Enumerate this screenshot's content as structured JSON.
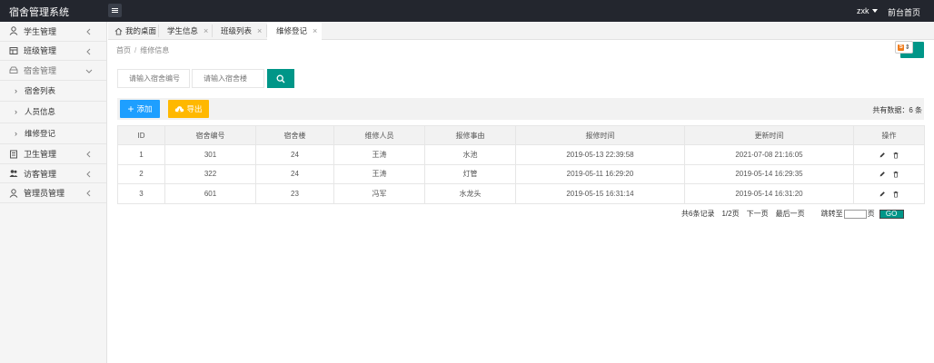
{
  "app": {
    "title": "宿舍管理系统"
  },
  "topbar": {
    "user": "zxk",
    "front_link": "前台首页"
  },
  "sidebar": {
    "items": [
      {
        "label": "学生管理",
        "icon": "user-icon",
        "arrow": "chevron-left"
      },
      {
        "label": "班级管理",
        "icon": "class-icon",
        "arrow": "chevron-left"
      },
      {
        "label": "宿舍管理",
        "icon": "dorm-icon",
        "arrow": "chevron-down"
      },
      {
        "label": "宿舍列表",
        "sub": true
      },
      {
        "label": "人员信息",
        "sub": true
      },
      {
        "label": "维修登记",
        "sub": true
      },
      {
        "label": "卫生管理",
        "icon": "hygiene-icon",
        "arrow": "chevron-left"
      },
      {
        "label": "访客管理",
        "icon": "visitor-icon",
        "arrow": "chevron-left"
      },
      {
        "label": "管理员管理",
        "icon": "admin-icon",
        "arrow": "chevron-left"
      }
    ]
  },
  "tabs": [
    {
      "label": "我的桌面"
    },
    {
      "label": "学生信息"
    },
    {
      "label": "班级列表"
    },
    {
      "label": "维修登记"
    }
  ],
  "breadcrumb": {
    "home": "首页",
    "current": "维修信息"
  },
  "search": {
    "dorm_no_placeholder": "请输入宿舍编号",
    "building_placeholder": "请输入宿舍楼"
  },
  "toolbar": {
    "add_label": "添加",
    "export_label": "导出",
    "total_text": "共有数据：6 条"
  },
  "table": {
    "headers": [
      "ID",
      "宿舍编号",
      "宿舍楼",
      "维修人员",
      "报修事由",
      "报修时间",
      "更新时间",
      "操作"
    ],
    "rows": [
      [
        "1",
        "301",
        "24",
        "王涛",
        "水池",
        "2019-05-13 22:39:58",
        "2021-07-08 21:16:05"
      ],
      [
        "2",
        "322",
        "24",
        "王涛",
        "灯管",
        "2019-05-11 16:29:20",
        "2019-05-14 16:29:35"
      ],
      [
        "3",
        "601",
        "23",
        "冯军",
        "水龙头",
        "2019-05-15 16:31:14",
        "2019-05-14 16:31:20"
      ]
    ]
  },
  "pager": {
    "summary": "共6条记录",
    "page": "1/2页",
    "next": "下一页",
    "last": "最后一页",
    "jump_label": "跳转至",
    "page_unit": "页",
    "go": "GO"
  },
  "colors": {
    "accent": "#009688",
    "add": "#1e9fff",
    "export": "#ffb800",
    "topbar": "#23262e"
  }
}
